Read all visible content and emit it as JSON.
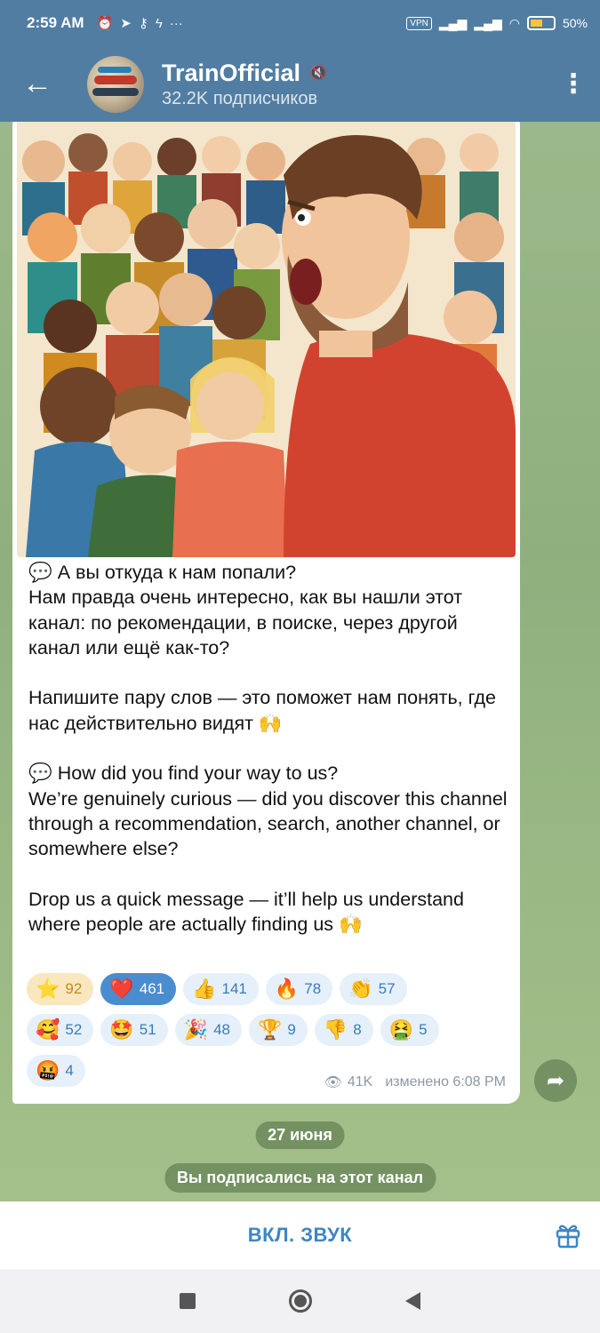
{
  "status_bar": {
    "time": "2:59 AM",
    "vpn": "VPN",
    "battery": "50%",
    "battery_level": 0.5
  },
  "header": {
    "title": "TrainOfficial",
    "subtitle": "32.2K подписчиков"
  },
  "message": {
    "text_ru_q": "💬 А вы откуда к нам попали?",
    "text_ru_body": "Нам правда очень интересно, как вы нашли этот канал: по рекомендации, в поиске, через другой канал или ещё как-то?",
    "text_ru_cta": "Напишите пару слов — это поможет нам понять, где нас действительно видят 🙌",
    "text_en_q": "💬 How did you find your way to us?",
    "text_en_body": "We’re genuinely curious — did you discover this channel through a recommendation, search, another channel, or somewhere else?",
    "text_en_cta": "Drop us a quick message — it’ll help us understand where people are actually finding us 🙌",
    "views": "41K",
    "edited": "изменено 6:08 PM"
  },
  "reactions": [
    {
      "emoji": "⭐",
      "count": "92"
    },
    {
      "emoji": "❤️",
      "count": "461"
    },
    {
      "emoji": "👍",
      "count": "141"
    },
    {
      "emoji": "🔥",
      "count": "78"
    },
    {
      "emoji": "👏",
      "count": "57"
    },
    {
      "emoji": "🥰",
      "count": "52"
    },
    {
      "emoji": "🤩",
      "count": "51"
    },
    {
      "emoji": "🎉",
      "count": "48"
    },
    {
      "emoji": "🏆",
      "count": "9"
    },
    {
      "emoji": "👎",
      "count": "8"
    },
    {
      "emoji": "🤮",
      "count": "5"
    },
    {
      "emoji": "🤬",
      "count": "4"
    }
  ],
  "date_separator": "27 июня",
  "service_message": "Вы подписались на этот канал",
  "bottom_bar": {
    "unmute_label": "ВКЛ. ЗВУК"
  },
  "colors": {
    "header_bg": "#517da2",
    "accent": "#3d85c6",
    "reaction_bg": "#e6f0fa",
    "reaction_selected": "#4a8cd0"
  }
}
